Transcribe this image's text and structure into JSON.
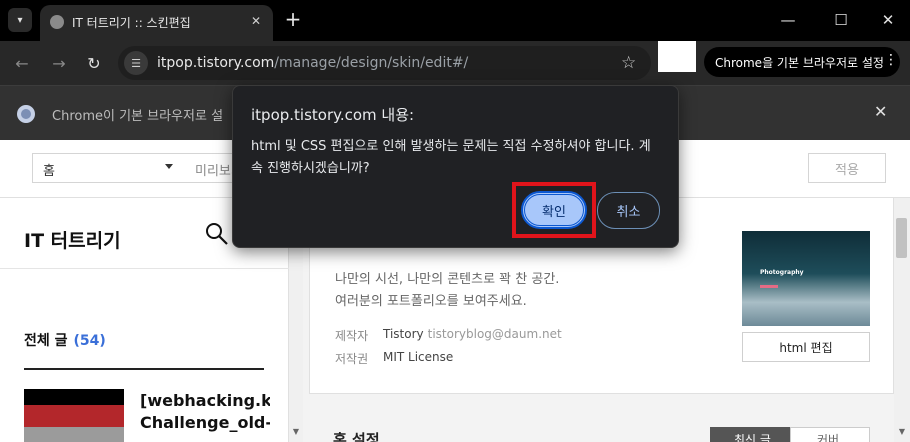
{
  "browser": {
    "tab_title": "IT 터트리기 :: 스킨편집",
    "url_host": "itpop.tistory.com",
    "url_path": "/manage/design/skin/edit#/",
    "default_browser_button": "Chrome을 기본 브라우저로 설정",
    "infobar_text": "Chrome이 기본 브라우저로 설"
  },
  "topbar": {
    "page_select_value": "홈",
    "preview_label": "미리보기",
    "apply_label": "적용"
  },
  "left_panel": {
    "blog_title": "IT 터트리기",
    "all_posts_label": "전체 글",
    "all_posts_count": "(54)",
    "post_title": "[webhacking.kr\nChallenge_old-"
  },
  "skin": {
    "desc_line1": "나만의 시선, 나만의 콘텐츠로 꽉 찬 공간.",
    "desc_line2": "여러분의 포트폴리오를 보여주세요.",
    "author_label": "제작자",
    "author_name": "Tistory",
    "author_email": "tistoryblog@daum.net",
    "license_label": "저작권",
    "license_value": "MIT License",
    "thumb_caption": "Photography",
    "html_edit_button": "html 편집"
  },
  "home_settings": {
    "title": "홈 설정",
    "latest_label": "최신 글",
    "cover_label": "커버"
  },
  "dialog": {
    "title": "itpop.tistory.com 내용:",
    "message": "html 및 CSS 편집으로 인해 발생하는 문제는 직접 수정하셔야 합니다. 계속 진행하시겠습니까?",
    "ok_label": "확인",
    "cancel_label": "취소"
  },
  "colors": {
    "accent_red_highlight": "#e0141b",
    "dialog_primary": "#a8c7fa",
    "post_count_blue": "#3a6fd8"
  }
}
